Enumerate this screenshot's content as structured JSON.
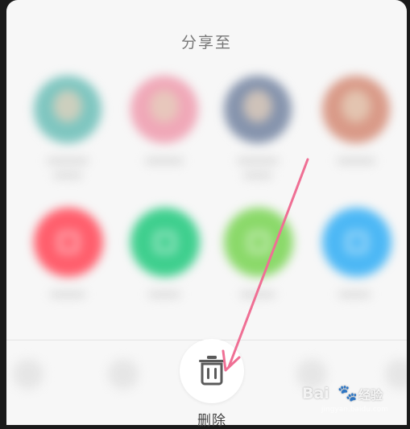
{
  "sheet": {
    "title": "分享至"
  },
  "contacts": [
    {
      "color": "#7fc6c0"
    },
    {
      "color": "#f0a8b8"
    },
    {
      "color": "#8694ad"
    },
    {
      "color": "#d99a88"
    }
  ],
  "apps": [
    {
      "color": "#ff5f6d",
      "icon": "app-red-icon"
    },
    {
      "color": "#3fcf8e",
      "icon": "app-green-icon"
    },
    {
      "color": "#8bd96a",
      "icon": "app-lightgreen-icon"
    },
    {
      "color": "#4db8f5",
      "icon": "app-blue-icon"
    }
  ],
  "actions": {
    "delete_label": "删除",
    "delete_icon": "trash-icon"
  },
  "watermark": {
    "brand": "Bai",
    "paw": "🐾",
    "sub": "经验",
    "url": "jingyan.baidu.com"
  },
  "annotation": {
    "color": "#ef6f94"
  }
}
